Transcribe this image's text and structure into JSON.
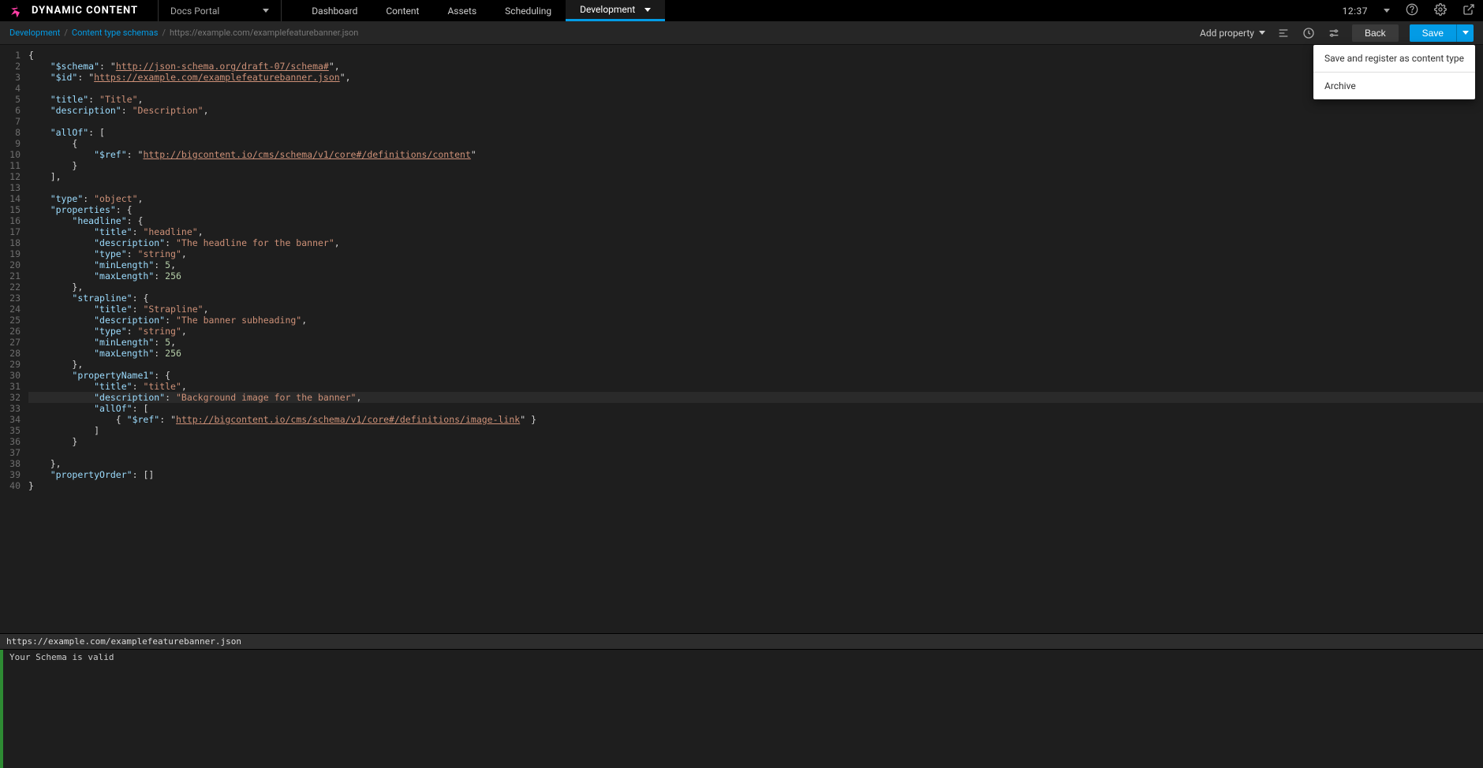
{
  "topbar": {
    "brand": "DYNAMIC CONTENT",
    "hub_label": "Docs Portal",
    "nav": [
      "Dashboard",
      "Content",
      "Assets",
      "Scheduling",
      "Development"
    ],
    "active_nav_index": 4,
    "clock": "12:37"
  },
  "breadcrumb": {
    "items": [
      "Development",
      "Content type schemas"
    ],
    "path": "https://example.com/examplefeaturebanner.json"
  },
  "actions": {
    "add_property_label": "Add property",
    "back_label": "Back",
    "save_label": "Save"
  },
  "save_menu": {
    "register_label": "Save and register as content type",
    "archive_label": "Archive"
  },
  "code_lines": [
    "{",
    "    \"$schema\": \"http://json-schema.org/draft-07/schema#\",",
    "    \"$id\": \"https://example.com/examplefeaturebanner.json\",",
    "",
    "    \"title\": \"Title\",",
    "    \"description\": \"Description\",",
    "",
    "    \"allOf\": [",
    "        {",
    "            \"$ref\": \"http://bigcontent.io/cms/schema/v1/core#/definitions/content\"",
    "        }",
    "    ],",
    "",
    "    \"type\": \"object\",",
    "    \"properties\": {",
    "        \"headline\": {",
    "            \"title\": \"headline\",",
    "            \"description\": \"The headline for the banner\",",
    "            \"type\": \"string\",",
    "            \"minLength\": 5,",
    "            \"maxLength\": 256",
    "        },",
    "        \"strapline\": {",
    "            \"title\": \"Strapline\",",
    "            \"description\": \"The banner subheading\",",
    "            \"type\": \"string\",",
    "            \"minLength\": 5,",
    "            \"maxLength\": 256",
    "        },",
    "        \"propertyName1\": {",
    "            \"title\": \"title\",",
    "            \"description\": \"Background image for the banner\",",
    "            \"allOf\": [",
    "                { \"$ref\": \"http://bigcontent.io/cms/schema/v1/core#/definitions/image-link\" }",
    "            ]",
    "        }",
    "",
    "    },",
    "    \"propertyOrder\": []",
    "}"
  ],
  "active_line": 32,
  "validation": {
    "file": "https://example.com/examplefeaturebanner.json",
    "message": "Your Schema is valid"
  }
}
